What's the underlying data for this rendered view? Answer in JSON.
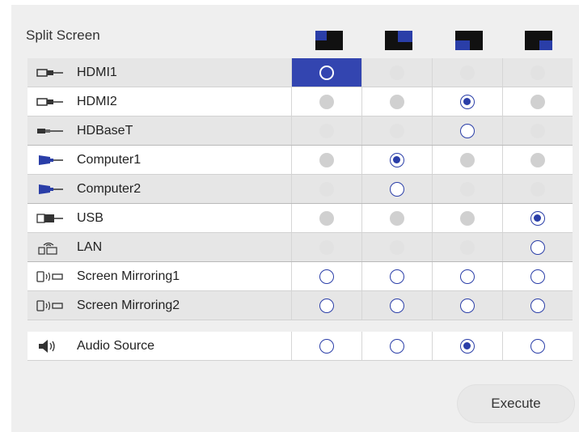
{
  "title": "Split Screen",
  "layout_options": [
    {
      "icon": "split-left-small-icon"
    },
    {
      "icon": "split-right-small-icon"
    },
    {
      "icon": "split-left-large-icon"
    },
    {
      "icon": "split-right-large-icon"
    }
  ],
  "colors": {
    "accent": "#2a3ea8",
    "selected_cell": "#3345b0"
  },
  "sources": [
    {
      "label": "HDMI1",
      "icon": "hdmi-icon",
      "states": [
        "focus-white",
        "disabled-faint",
        "disabled-faint",
        "disabled-faint"
      ],
      "selected_col": 0
    },
    {
      "label": "HDMI2",
      "icon": "hdmi-icon",
      "states": [
        "disabled",
        "disabled",
        "checked",
        "disabled"
      ]
    },
    {
      "label": "HDBaseT",
      "icon": "hdbaset-icon",
      "states": [
        "disabled-faint",
        "disabled-faint",
        "open",
        "disabled-faint"
      ]
    },
    {
      "label": "Computer1",
      "icon": "computer-icon",
      "states": [
        "disabled",
        "checked",
        "disabled",
        "disabled"
      ]
    },
    {
      "label": "Computer2",
      "icon": "computer-icon",
      "states": [
        "disabled-faint",
        "open",
        "disabled-faint",
        "disabled-faint"
      ]
    },
    {
      "label": "USB",
      "icon": "usb-icon",
      "states": [
        "disabled",
        "disabled",
        "disabled",
        "checked"
      ]
    },
    {
      "label": "LAN",
      "icon": "lan-icon",
      "states": [
        "disabled-faint",
        "disabled-faint",
        "disabled-faint",
        "open"
      ]
    },
    {
      "label": "Screen Mirroring1",
      "icon": "screen-mirroring-icon",
      "states": [
        "open",
        "open",
        "open",
        "open"
      ]
    },
    {
      "label": "Screen Mirroring2",
      "icon": "screen-mirroring-icon",
      "states": [
        "open",
        "open",
        "open",
        "open"
      ]
    }
  ],
  "audio": {
    "label": "Audio Source",
    "icon": "speaker-icon",
    "states": [
      "open",
      "open",
      "checked",
      "open"
    ]
  },
  "execute_label": "Execute"
}
